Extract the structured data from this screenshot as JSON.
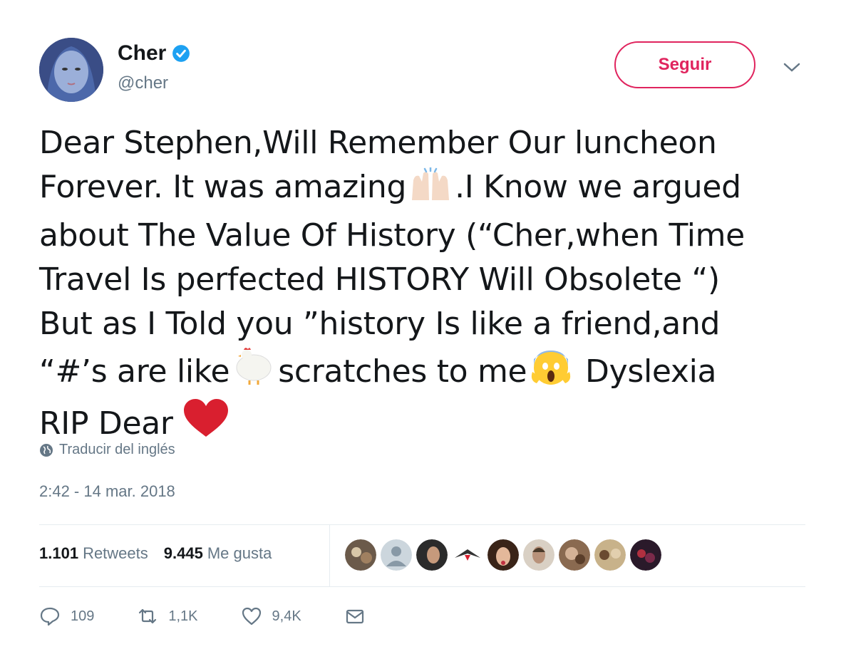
{
  "user": {
    "name": "Cher",
    "handle": "@cher",
    "verified_icon": "verified-badge-icon"
  },
  "follow_button": {
    "label": "Seguir"
  },
  "tweet": {
    "line1": "Dear Stephen,Will Remember Our luncheon",
    "line2a": "Forever. It was amazing",
    "line2b": ".I Know we argued",
    "line3": "about The Value Of History (“Cher,when Time",
    "line4": "Travel Is perfected HISTORY Will Obsolete “)",
    "line5": "But as I Told you ”history Is like a friend,and",
    "line6a": "“#’s are like",
    "line6b": "scratches to me",
    "line6c": " Dyslexia",
    "line7": "RIP Dear "
  },
  "translate_label": "Traducir del inglés",
  "timestamp": "2:42 - 14 mar. 2018",
  "stats": {
    "retweets_count": "1.101",
    "retweets_label": "Retweets",
    "likes_count": "9.445",
    "likes_label": "Me gusta"
  },
  "actions": {
    "reply_count": "109",
    "retweet_count": "1,1K",
    "like_count": "9,4K"
  },
  "colors": {
    "accent": "#e0245e",
    "verified": "#1da1f2",
    "secondary_text": "#657786"
  }
}
